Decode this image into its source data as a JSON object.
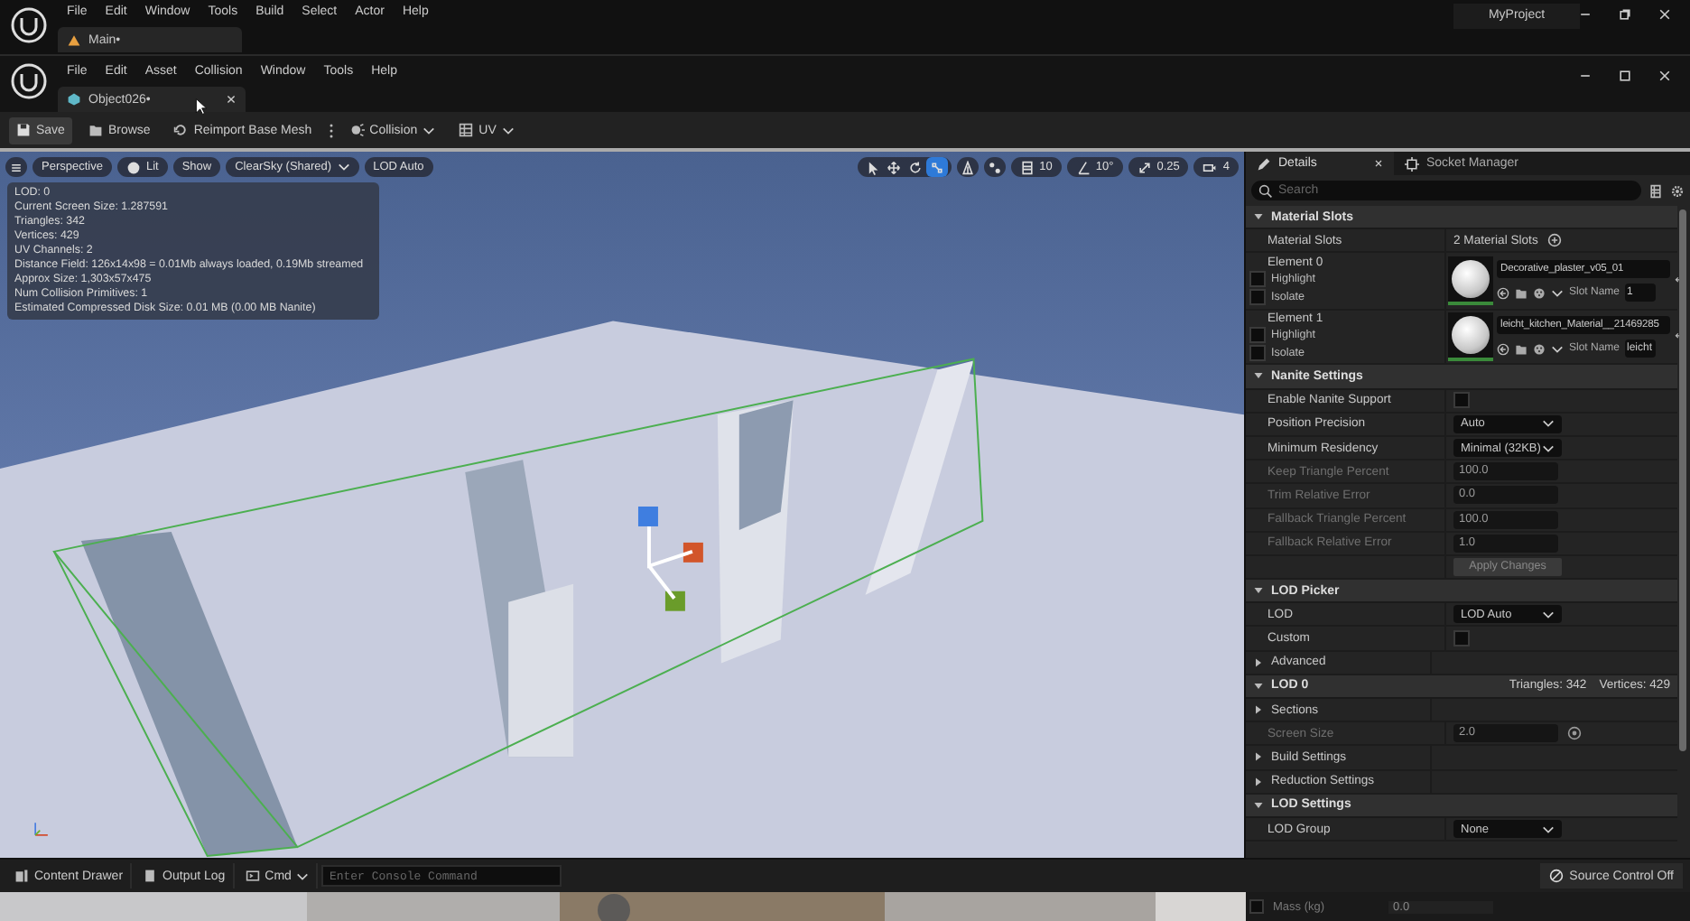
{
  "app_window": {
    "menu": [
      "File",
      "Edit",
      "Window",
      "Tools",
      "Build",
      "Select",
      "Actor",
      "Help"
    ],
    "tab": "Main•",
    "project": "MyProject"
  },
  "editor_window": {
    "menu": [
      "File",
      "Edit",
      "Asset",
      "Collision",
      "Window",
      "Tools",
      "Help"
    ],
    "tab": "Object026•"
  },
  "toolbar": [
    {
      "kind": "save",
      "label": "Save"
    },
    {
      "kind": "browse",
      "label": "Browse"
    },
    {
      "kind": "reimport",
      "label": "Reimport Base Mesh"
    },
    {
      "kind": "more"
    },
    {
      "kind": "collision",
      "label": "Collision"
    },
    {
      "kind": "uv",
      "label": "UV"
    }
  ],
  "viewport": {
    "buttons": [
      {
        "kind": "menu"
      },
      {
        "kind": "text",
        "label": "Perspective"
      },
      {
        "kind": "lit",
        "label": "Lit"
      },
      {
        "kind": "text",
        "label": "Show"
      },
      {
        "kind": "dropdown",
        "label": "ClearSky (Shared)"
      },
      {
        "kind": "text",
        "label": "LOD Auto"
      }
    ],
    "transform_tools": [
      {
        "kind": "select",
        "selected": false
      },
      {
        "kind": "move",
        "selected": false
      },
      {
        "kind": "rotate",
        "selected": false
      },
      {
        "kind": "scale",
        "selected": true
      }
    ],
    "snaps": [
      {
        "kind": "surface"
      },
      {
        "kind": "local"
      },
      {
        "kind": "grid",
        "label": "10"
      },
      {
        "kind": "angle",
        "label": "10°"
      },
      {
        "kind": "scale",
        "label": "0.25"
      },
      {
        "kind": "camera",
        "label": "4"
      }
    ],
    "stats": [
      "LOD: 0",
      "Current Screen Size: 1.287591",
      "Triangles: 342",
      "Vertices: 429",
      "UV Channels: 2",
      "Distance Field: 126x14x98 = 0.01Mb always loaded, 0.19Mb streamed",
      "Approx Size: 1,303x57x475",
      "Num Collision Primitives: 1",
      "Estimated Compressed Disk Size: 0.01 MB (0.00 MB Nanite)"
    ]
  },
  "details": {
    "tabs": [
      {
        "label": "Details",
        "selected": true
      },
      {
        "label": "Socket Manager",
        "selected": false
      }
    ],
    "search_placeholder": "Search",
    "sections": [
      {
        "title": "Material Slots",
        "expanded": true,
        "rows": [
          {
            "kind": "summary",
            "label": "Material Slots",
            "value": "2 Material Slots"
          },
          {
            "kind": "material",
            "label": "Element 0",
            "material": "Decorative_plaster_v05_01",
            "slot_label": "Slot Name",
            "slot_name": "1",
            "options": [
              {
                "label": "Highlight",
                "checked": false
              },
              {
                "label": "Isolate",
                "checked": false
              }
            ]
          },
          {
            "kind": "material",
            "label": "Element 1",
            "material": "leicht_kitchen_Material__21469285",
            "slot_label": "Slot Name",
            "slot_name": "leicht",
            "options": [
              {
                "label": "Highlight",
                "checked": false
              },
              {
                "label": "Isolate",
                "checked": false
              }
            ]
          }
        ]
      },
      {
        "title": "Nanite Settings",
        "expanded": true,
        "rows": [
          {
            "kind": "checkbox",
            "label": "Enable Nanite Support",
            "checked": false
          },
          {
            "kind": "dropdown",
            "label": "Position Precision",
            "value": "Auto"
          },
          {
            "kind": "dropdown",
            "label": "Minimum Residency",
            "value": "Minimal (32KB)"
          },
          {
            "kind": "number",
            "label": "Keep Triangle Percent",
            "value": "100.0",
            "disabled": true
          },
          {
            "kind": "number",
            "label": "Trim Relative Error",
            "value": "0.0",
            "disabled": true
          },
          {
            "kind": "number",
            "label": "Fallback Triangle Percent",
            "value": "100.0",
            "disabled": true
          },
          {
            "kind": "number",
            "label": "Fallback Relative Error",
            "value": "1.0",
            "disabled": true
          },
          {
            "kind": "button",
            "label": "Apply Changes",
            "disabled": true
          }
        ]
      },
      {
        "title": "LOD Picker",
        "expanded": true,
        "rows": [
          {
            "kind": "dropdown",
            "label": "LOD",
            "value": "LOD Auto"
          },
          {
            "kind": "checkbox",
            "label": "Custom",
            "checked": false
          },
          {
            "kind": "group",
            "label": "Advanced",
            "expanded": false
          }
        ]
      },
      {
        "title": "LOD 0",
        "expanded": true,
        "header_stats": [
          "Triangles: 342",
          "Vertices: 429"
        ],
        "rows": [
          {
            "kind": "group",
            "label": "Sections",
            "expanded": false
          },
          {
            "kind": "number",
            "label": "Screen Size",
            "value": "2.0",
            "disabled": true,
            "reset": true
          },
          {
            "kind": "group",
            "label": "Build Settings",
            "expanded": false
          },
          {
            "kind": "group",
            "label": "Reduction Settings",
            "expanded": false
          }
        ]
      },
      {
        "title": "LOD Settings",
        "expanded": true,
        "rows": [
          {
            "kind": "dropdown",
            "label": "LOD Group",
            "value": "None"
          }
        ]
      }
    ]
  },
  "bottom_bar": {
    "content_drawer": "Content Drawer",
    "output_log": "Output Log",
    "cmd": "Cmd",
    "console_placeholder": "Enter Console Command",
    "source_control": "Source Control Off"
  },
  "background_window": {
    "label": "Mass (kg)",
    "value": "0.0",
    "checked": false
  }
}
